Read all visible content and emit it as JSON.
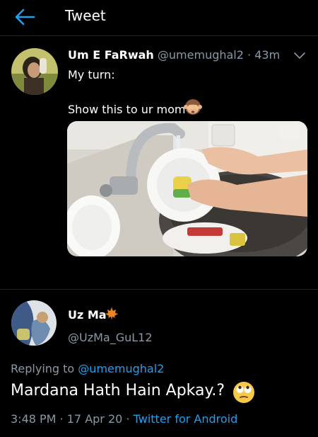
{
  "header": {
    "title": "Tweet"
  },
  "tweet": {
    "author_name": "Um E FaRwah",
    "author_handle": "@umemughal2",
    "time_sep": "·",
    "time_ago": "43m",
    "text_line1": "My turn:",
    "text_line2": "Show this to ur mom",
    "emoji_icon": "see-no-evil-monkey-icon",
    "media_icon": "photo-washing-dishes"
  },
  "reply": {
    "author_name": "Uz Ma",
    "name_icon": "maple-leaf-icon",
    "author_handle": "@UzMa_GuL12",
    "replying_to_label": "Replying to",
    "replying_to_handle": "@umemughal2",
    "text": "Mardana Hath Hain Apkay.?",
    "text_emoji_icon": "face-with-rolling-eyes-icon",
    "time": "3:48 PM",
    "sep1": "·",
    "date": "17 Apr 20",
    "sep2": "·",
    "source": "Twitter for Android"
  },
  "colors": {
    "background": "#000000",
    "text": "#ffffff",
    "muted": "#8899a6",
    "link": "#1da1f2"
  }
}
